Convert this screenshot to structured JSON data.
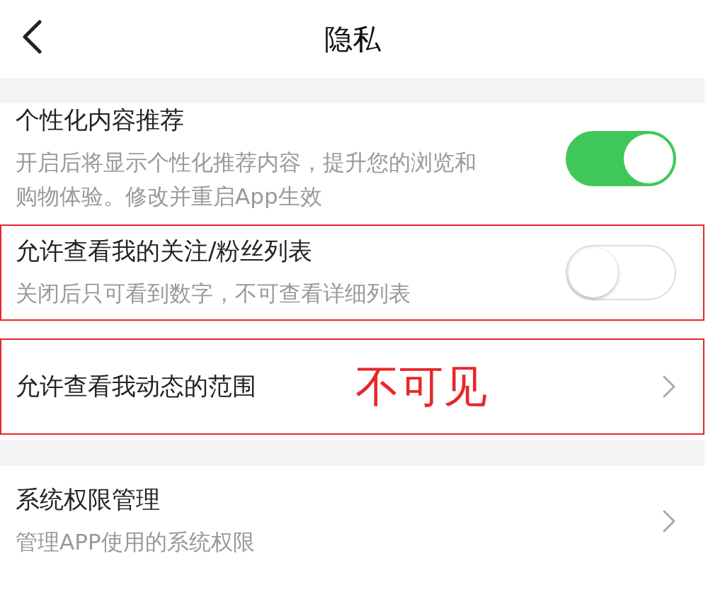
{
  "header": {
    "title": "隐私"
  },
  "sections": [
    {
      "items": [
        {
          "kind": "toggle",
          "title": "个性化内容推荐",
          "description": "开启后将显示个性化推荐内容，提升您的浏览和购物体验。修改并重启App生效",
          "on": true,
          "highlighted": false
        },
        {
          "kind": "toggle",
          "title": "允许查看我的关注/粉丝列表",
          "description": "关闭后只可看到数字，不可查看详细列表",
          "on": false,
          "highlighted": true
        },
        {
          "kind": "link",
          "title": "允许查看我动态的范围",
          "note": "不可见",
          "highlighted": true
        }
      ]
    },
    {
      "items": [
        {
          "kind": "link",
          "title": "系统权限管理",
          "description": "管理APP使用的系统权限",
          "highlighted": false
        }
      ]
    }
  ]
}
